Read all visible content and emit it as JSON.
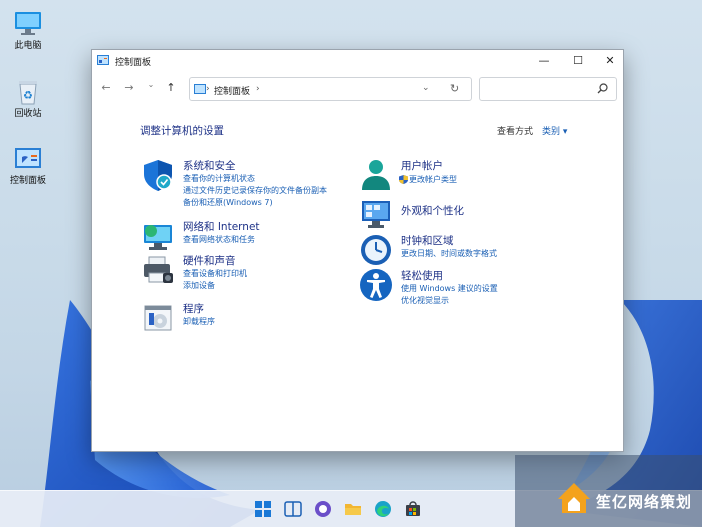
{
  "desktop": {
    "icons": [
      {
        "label": "此电脑",
        "icon": "monitor-icon"
      },
      {
        "label": "回收站",
        "icon": "recycle-bin-icon"
      },
      {
        "label": "控制面板",
        "icon": "control-panel-icon"
      }
    ]
  },
  "window": {
    "title": "控制面板",
    "controls": {
      "minimize": "—",
      "maximize": "☐",
      "close": "✕"
    },
    "nav": {
      "back": "←",
      "forward": "→",
      "down": "⌄",
      "up": "↑"
    },
    "address": {
      "path": "控制面板",
      "separator": "›",
      "dropdown": "⌄",
      "refresh": "↻"
    },
    "search": {
      "value": "",
      "placeholder": ""
    },
    "heading": "调整计算机的设置",
    "view_by_label": "查看方式",
    "view_mode": "类别 ▾",
    "categories_left": [
      {
        "title": "系统和安全",
        "icon": "shield-icon",
        "links": [
          "查看你的计算机状态",
          "通过文件历史记录保存你的文件备份副本",
          "备份和还原(Windows 7)"
        ]
      },
      {
        "title": "网络和 Internet",
        "icon": "network-icon",
        "links": [
          "查看网络状态和任务"
        ]
      },
      {
        "title": "硬件和声音",
        "icon": "printer-icon",
        "links": [
          "查看设备和打印机",
          "添加设备"
        ]
      },
      {
        "title": "程序",
        "icon": "programs-icon",
        "links": [
          "卸载程序"
        ]
      }
    ],
    "categories_right": [
      {
        "title": "用户帐户",
        "icon": "user-accounts-icon",
        "links": [
          "更改帐户类型"
        ]
      },
      {
        "title": "外观和个性化",
        "icon": "appearance-icon",
        "links": []
      },
      {
        "title": "时钟和区域",
        "icon": "clock-icon",
        "links": [
          "更改日期、时间或数字格式"
        ]
      },
      {
        "title": "轻松使用",
        "icon": "accessibility-icon",
        "links": [
          "使用 Windows 建议的设置",
          "优化视觉显示"
        ]
      }
    ]
  },
  "taskbar": {
    "icons": [
      "start-icon",
      "widgets-icon",
      "chat-icon",
      "file-explorer-icon",
      "edge-icon",
      "store-icon"
    ]
  },
  "watermark": {
    "text": "笙亿网络策划"
  }
}
